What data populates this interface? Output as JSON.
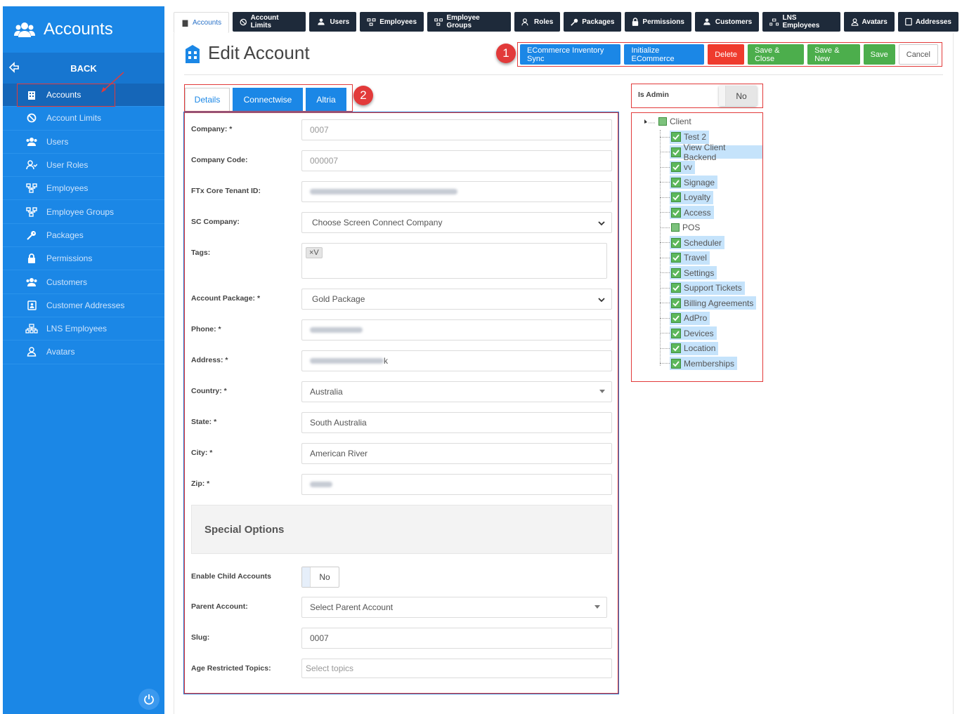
{
  "sidebar": {
    "brand": "Accounts",
    "back": "BACK",
    "items": [
      {
        "label": "Accounts",
        "icon": "building-icon",
        "active": true
      },
      {
        "label": "Account Limits",
        "icon": "ban-icon"
      },
      {
        "label": "Users",
        "icon": "users-icon"
      },
      {
        "label": "User Roles",
        "icon": "user-check-icon"
      },
      {
        "label": "Employees",
        "icon": "sitemap-icon"
      },
      {
        "label": "Employee Groups",
        "icon": "sitemap-icon"
      },
      {
        "label": "Packages",
        "icon": "key-icon"
      },
      {
        "label": "Permissions",
        "icon": "lock-icon"
      },
      {
        "label": "Customers",
        "icon": "users-icon"
      },
      {
        "label": "Customer Addresses",
        "icon": "address-book-icon"
      },
      {
        "label": "LNS Employees",
        "icon": "org-chart-icon"
      },
      {
        "label": "Avatars",
        "icon": "user-icon"
      }
    ]
  },
  "tabs": [
    {
      "label": "Accounts",
      "selected": true
    },
    {
      "label": "Account Limits"
    },
    {
      "label": "Users"
    },
    {
      "label": "Employees"
    },
    {
      "label": "Employee Groups"
    },
    {
      "label": "Roles"
    },
    {
      "label": "Packages"
    },
    {
      "label": "Permissions"
    },
    {
      "label": "Customers"
    },
    {
      "label": "LNS Employees"
    },
    {
      "label": "Avatars"
    },
    {
      "label": "Addresses"
    }
  ],
  "page_title": "Edit Account",
  "actions": {
    "ecommerce_sync": "ECommerce Inventory Sync",
    "init_ecommerce": "Initialize ECommerce",
    "delete": "Delete",
    "save_close": "Save & Close",
    "save_new": "Save & New",
    "save": "Save",
    "cancel": "Cancel"
  },
  "badges": {
    "one": "1",
    "two": "2"
  },
  "subtabs": {
    "details": "Details",
    "connectwise": "Connectwise",
    "altria": "Altria"
  },
  "form": {
    "company": {
      "label": "Company: *",
      "value": "0007"
    },
    "company_code": {
      "label": "Company Code:",
      "value": "000007"
    },
    "ftx_tenant": {
      "label": "FTx Core Tenant ID:"
    },
    "sc_company": {
      "label": "SC Company:",
      "value": "Choose Screen Connect Company"
    },
    "tags": {
      "label": "Tags:",
      "chip": "×V"
    },
    "account_package": {
      "label": "Account Package: *",
      "value": "Gold Package"
    },
    "phone": {
      "label": "Phone: *"
    },
    "address": {
      "label": "Address: *",
      "value": "k"
    },
    "country": {
      "label": "Country: *",
      "value": "Australia"
    },
    "state": {
      "label": "State: *",
      "value": "South Australia"
    },
    "city": {
      "label": "City: *",
      "value": "American River"
    },
    "zip": {
      "label": "Zip: *"
    },
    "special_options": "Special Options",
    "enable_child": {
      "label": "Enable Child Accounts",
      "value": "No"
    },
    "parent_account": {
      "label": "Parent Account:",
      "value": "Select Parent Account"
    },
    "slug": {
      "label": "Slug:",
      "value": "0007"
    },
    "age_topics": {
      "label": "Age Restricted Topics:",
      "placeholder": "Select topics"
    }
  },
  "is_admin": {
    "label": "Is Admin",
    "value": "No"
  },
  "tree": {
    "root": "Client",
    "nodes": [
      {
        "label": "Test 2",
        "checked": true
      },
      {
        "label": "View Client Backend",
        "checked": true
      },
      {
        "label": "vv",
        "checked": true
      },
      {
        "label": "Signage",
        "checked": true
      },
      {
        "label": "Loyalty",
        "checked": true
      },
      {
        "label": "Access",
        "checked": true
      },
      {
        "label": "POS",
        "checked": false
      },
      {
        "label": "Scheduler",
        "checked": true
      },
      {
        "label": "Travel",
        "checked": true
      },
      {
        "label": "Settings",
        "checked": true
      },
      {
        "label": "Support Tickets",
        "checked": true
      },
      {
        "label": "Billing Agreements",
        "checked": true
      },
      {
        "label": "AdPro",
        "checked": true
      },
      {
        "label": "Devices",
        "checked": true
      },
      {
        "label": "Location",
        "checked": true
      },
      {
        "label": "Memberships",
        "checked": true
      }
    ]
  }
}
